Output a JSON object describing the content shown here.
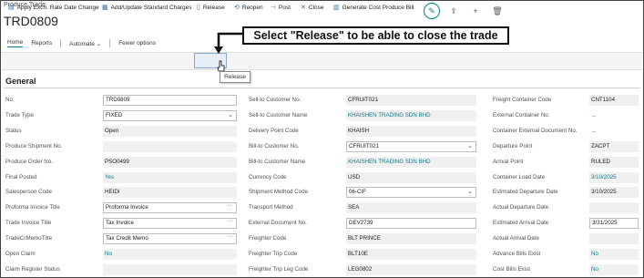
{
  "header": {
    "breadcrumb": "Produce Trade",
    "record_title": "TRD0809"
  },
  "nav": {
    "home": "Home",
    "reports": "Reports",
    "automate": "Automate",
    "fewer": "Fewer options"
  },
  "callout": "Select \"Release\" to be able to close the trade",
  "actions": {
    "apply_exch": "Apply Exch. Rate Date Change",
    "add_update": "Add/Update Standard Charges",
    "release": "Release",
    "reopen": "Reopen",
    "post": "Post",
    "close": "Close",
    "generate": "Generate Cost Produce Bill"
  },
  "tooltip": "Release",
  "section": "General",
  "col1": [
    {
      "label": "No.",
      "value": "TRD0809",
      "kind": "ed"
    },
    {
      "label": "Trade Type",
      "value": "FIXED",
      "kind": "ed",
      "suffix": "⌄"
    },
    {
      "label": "Status",
      "value": "Open",
      "kind": "ro"
    },
    {
      "label": "Produce Shipment No.",
      "value": "",
      "kind": "ro"
    },
    {
      "label": "Produce Order No.",
      "value": "PSO0499",
      "kind": "ro"
    },
    {
      "label": "Final Posted",
      "value": "Yes",
      "kind": "ro",
      "link": true
    },
    {
      "label": "Salesperson Code",
      "value": "HEIDI",
      "kind": "ro"
    },
    {
      "label": "Proforma Invoice Title",
      "value": "Proforma Invoice",
      "kind": "ed",
      "suffix": "···"
    },
    {
      "label": "Trade Invoice Title",
      "value": "Tax Invoice",
      "kind": "ed",
      "suffix": "···"
    },
    {
      "label": "TradeCrMemoTitle",
      "value": "Tax Credit Memo",
      "kind": "ed",
      "suffix": "···"
    },
    {
      "label": "Open Claim",
      "value": "No",
      "kind": "ro",
      "link": true
    },
    {
      "label": "Claim Register Status",
      "value": "",
      "kind": "ro"
    }
  ],
  "col2": [
    {
      "label": "Sell-to Customer No.",
      "value": "CFRUIT021",
      "kind": "ro"
    },
    {
      "label": "Sell-to Customer Name",
      "value": "KHAISHEN TRADING SDN BHD",
      "kind": "ro",
      "link": true
    },
    {
      "label": "Delivery Point Code",
      "value": "KHAISH",
      "kind": "ro"
    },
    {
      "label": "Bill-to Customer No.",
      "value": "CFRUIT021",
      "kind": "ed",
      "suffix": "⌄"
    },
    {
      "label": "Bill-to Customer Name",
      "value": "KHAISHEN TRADING SDN BHD",
      "kind": "ro",
      "link": true
    },
    {
      "label": "Currency Code",
      "value": "USD",
      "kind": "ro"
    },
    {
      "label": "Shipment Method Code",
      "value": "06-CIF",
      "kind": "ed",
      "suffix": "⌄"
    },
    {
      "label": "Transport Method",
      "value": "SEA",
      "kind": "ro"
    },
    {
      "label": "External Document No.",
      "value": "DEV2739",
      "kind": "ed"
    },
    {
      "label": "Freighter Code",
      "value": "BLT PRINCE",
      "kind": "ro"
    },
    {
      "label": "Freighter Trip Code",
      "value": "BLT10E",
      "kind": "ro"
    },
    {
      "label": "Freighter Trip Leg Code",
      "value": "LEG0802",
      "kind": "ro"
    }
  ],
  "col3": [
    {
      "label": "Freight Container Code",
      "value": "CNT1104",
      "kind": "ro"
    },
    {
      "label": "External Container No.",
      "value": "_",
      "kind": "dash"
    },
    {
      "label": "Container External Document No.",
      "value": "_",
      "kind": "dash"
    },
    {
      "label": "Departure Point",
      "value": "ZACPT",
      "kind": "ro"
    },
    {
      "label": "Arrival Point",
      "value": "RULED",
      "kind": "ro"
    },
    {
      "label": "Container Load Date",
      "value": "3/10/2025",
      "kind": "ro",
      "link": true
    },
    {
      "label": "Estimated Departure Date",
      "value": "3/10/2025",
      "kind": "ro"
    },
    {
      "label": "Actual Departure Date",
      "value": "",
      "kind": "ro"
    },
    {
      "label": "Estimated Arrival Date",
      "value": "3/31/2025",
      "kind": "ed"
    },
    {
      "label": "Actual Arrival Date",
      "value": "",
      "kind": "ro"
    },
    {
      "label": "Advance Bills Exist",
      "value": "No",
      "kind": "ro",
      "link": true
    },
    {
      "label": "Cost Bills Exist",
      "value": "No",
      "kind": "ro",
      "link": true
    }
  ]
}
